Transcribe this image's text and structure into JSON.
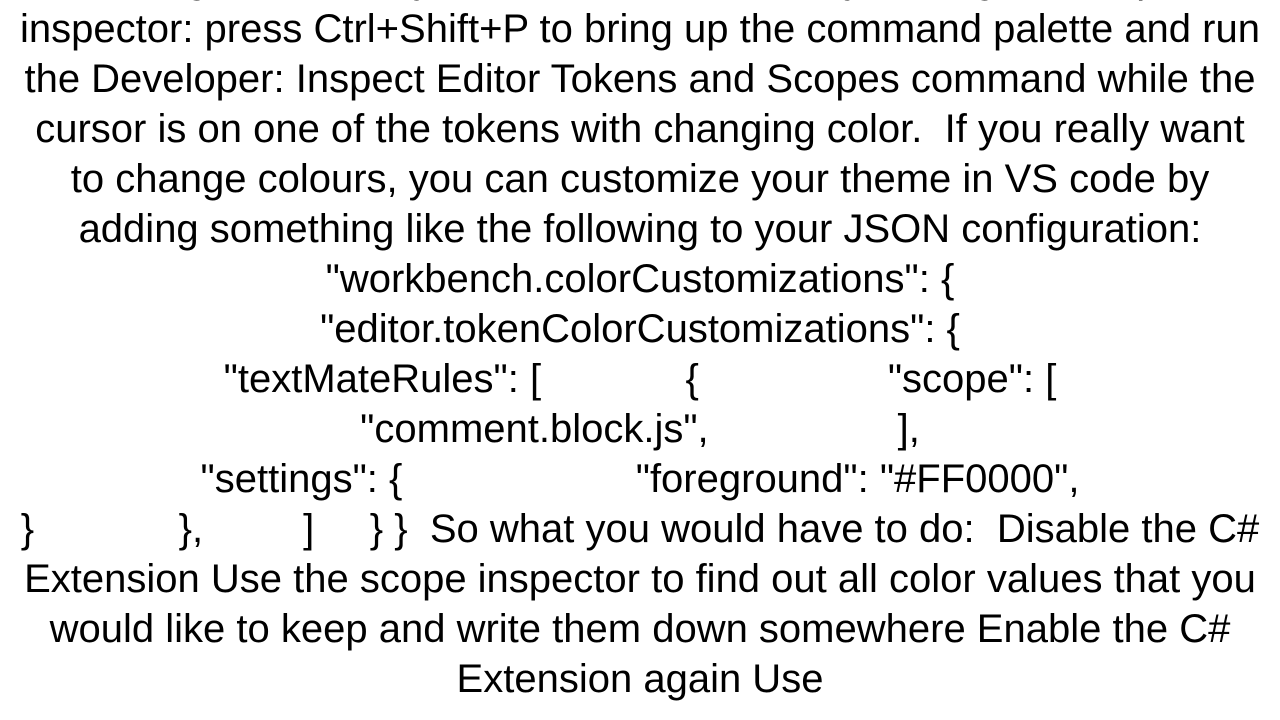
{
  "document": {
    "body": "change colors only, that can be done easily.  Using the scope inspector: press Ctrl+Shift+P to bring up the command palette and run the Developer: Inspect Editor Tokens and Scopes command while the cursor is on one of the tokens with changing color.  If you really want to change colours, you can customize your theme in VS code by adding something like the following to your JSON configuration:\n\"workbench.colorCustomizations\": {\n\"editor.tokenColorCustomizations\": {\n\"textMateRules\": [             {                 \"scope\": [\n\"comment.block.js\",                 ],\n\"settings\": {                     \"foreground\": \"#FF0000\",\n}             },         ]     } }  So what you would have to do:  Disable the C# Extension Use the scope inspector to find out all color values that you would like to keep and write them down somewhere Enable the C# Extension again Use"
  }
}
